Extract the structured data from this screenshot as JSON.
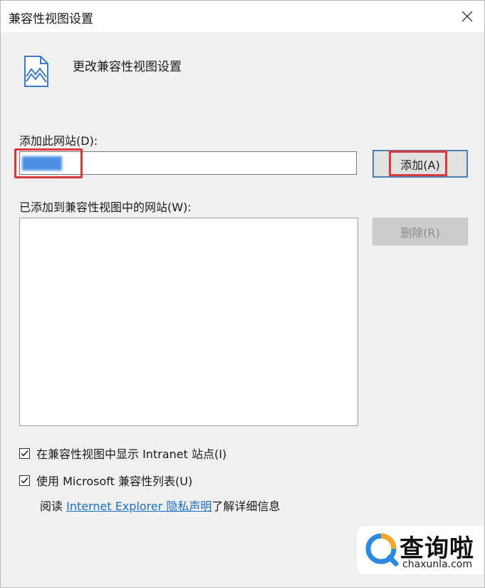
{
  "window": {
    "title": "兼容性视图设置"
  },
  "header": {
    "text": "更改兼容性视图设置",
    "icon": "compat-view-page-icon"
  },
  "add_section": {
    "label": "添加此网站(D):",
    "input_value": "",
    "add_button": "添加(A)"
  },
  "list_section": {
    "label": "已添加到兼容性视图中的网站(W):",
    "sites": [],
    "remove_button": "删除(R)"
  },
  "options": [
    {
      "label": "在兼容性视图中显示 Intranet 站点(I)",
      "checked": true
    },
    {
      "label": "使用 Microsoft 兼容性列表(U)",
      "checked": true
    }
  ],
  "privacy": {
    "prefix": "阅读 ",
    "link": "Internet Explorer 隐私声明",
    "suffix": "了解详细信息"
  },
  "watermark": {
    "name": "查询啦",
    "domain": "chaxunla.com"
  },
  "colors": {
    "highlight": "#d9383c",
    "link": "#1a6fc2",
    "accent": "#4d7fb0"
  }
}
